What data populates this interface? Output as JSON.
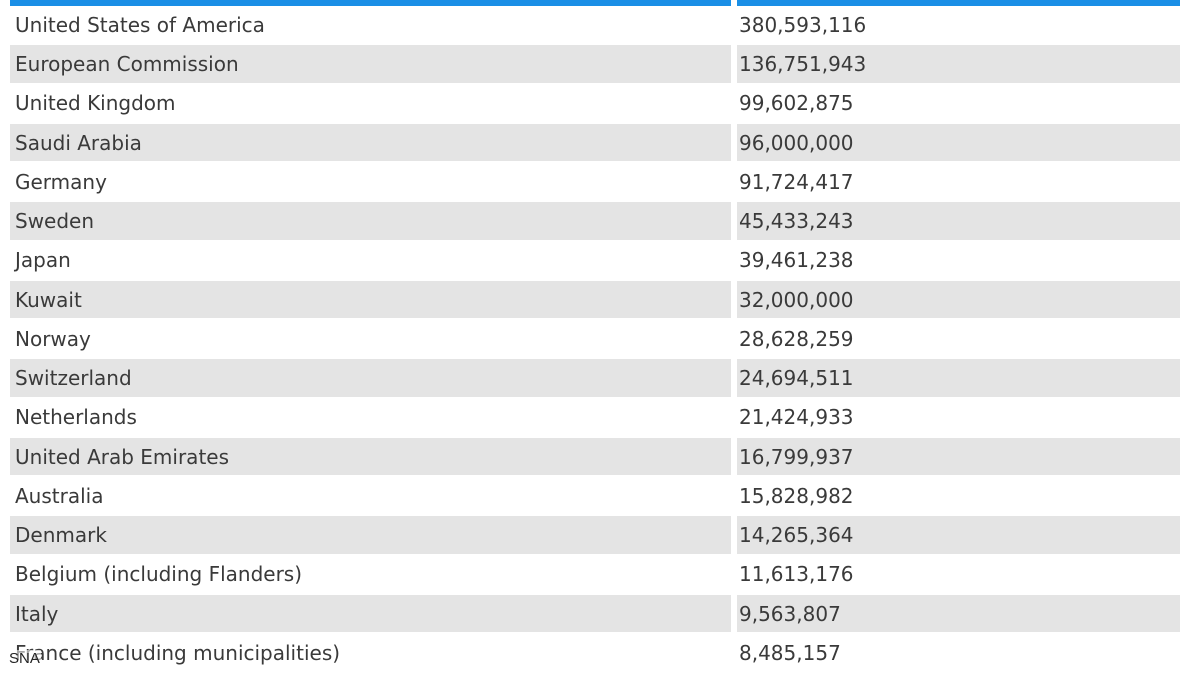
{
  "colors": {
    "header_accent": "#1a8fe6",
    "row_shade": "#e4e4e4"
  },
  "table": {
    "rows": [
      {
        "country": "United States of America",
        "amount": "380,593,116"
      },
      {
        "country": "European Commission",
        "amount": "136,751,943"
      },
      {
        "country": "United Kingdom",
        "amount": "99,602,875"
      },
      {
        "country": "Saudi Arabia",
        "amount": "96,000,000"
      },
      {
        "country": "Germany",
        "amount": "91,724,417"
      },
      {
        "country": "Sweden",
        "amount": "45,433,243"
      },
      {
        "country": "Japan",
        "amount": "39,461,238"
      },
      {
        "country": "Kuwait",
        "amount": "32,000,000"
      },
      {
        "country": "Norway",
        "amount": "28,628,259"
      },
      {
        "country": "Switzerland",
        "amount": "24,694,511"
      },
      {
        "country": "Netherlands",
        "amount": "21,424,933"
      },
      {
        "country": "United Arab Emirates",
        "amount": "16,799,937"
      },
      {
        "country": "Australia",
        "amount": "15,828,982"
      },
      {
        "country": "Denmark",
        "amount": "14,265,364"
      },
      {
        "country": "Belgium (including Flanders)",
        "amount": "11,613,176"
      },
      {
        "country": "Italy",
        "amount": "9,563,807"
      },
      {
        "country": "France (including municipalities)",
        "amount": "8,485,157"
      }
    ]
  },
  "watermark": "SNA"
}
